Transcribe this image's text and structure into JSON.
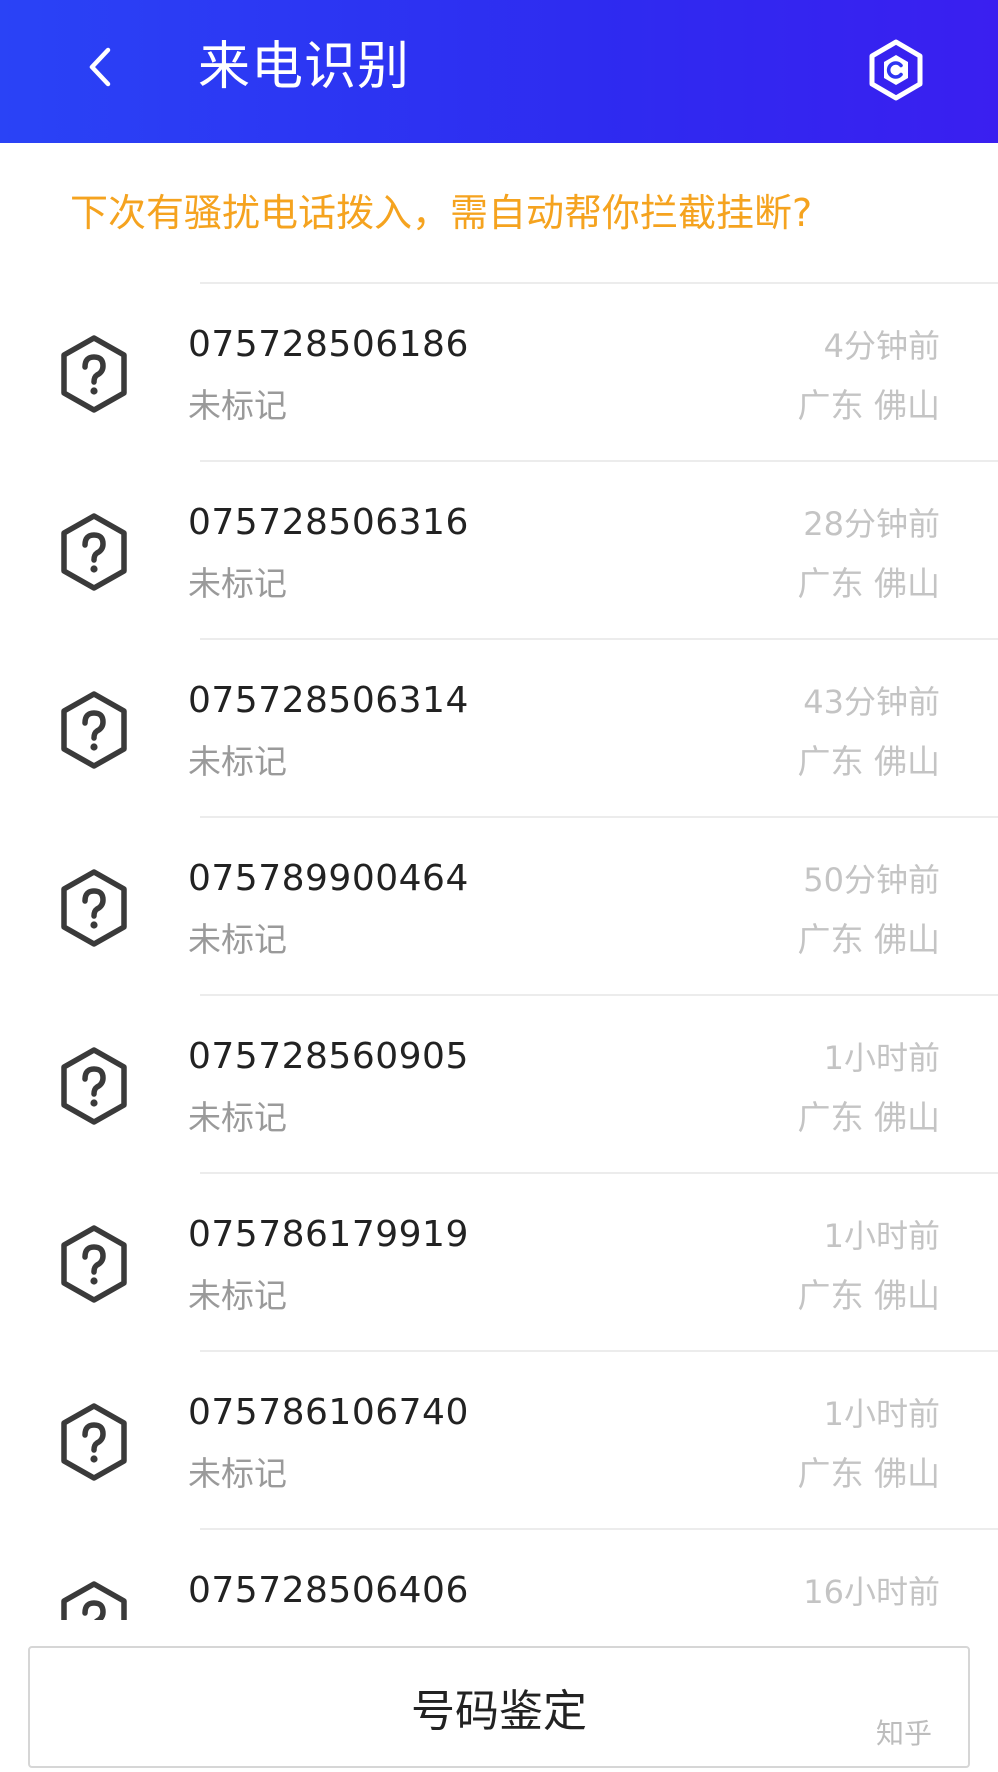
{
  "header": {
    "title": "来电识别",
    "back_icon": "chevron-left-icon",
    "settings_icon": "hexagon-settings-icon",
    "gradient_start": "#2a43f6",
    "gradient_end": "#3a1ff0"
  },
  "prompt": {
    "text": "下次有骚扰电话拨入，需自动帮你拦截挂断?",
    "color": "#f5a31f"
  },
  "calls": [
    {
      "number": "075728506186",
      "status": "未标记",
      "time": "4分钟前",
      "location": "广东 佛山",
      "icon": "hexagon-question-icon"
    },
    {
      "number": "075728506316",
      "status": "未标记",
      "time": "28分钟前",
      "location": "广东 佛山",
      "icon": "hexagon-question-icon"
    },
    {
      "number": "075728506314",
      "status": "未标记",
      "time": "43分钟前",
      "location": "广东 佛山",
      "icon": "hexagon-question-icon"
    },
    {
      "number": "075789900464",
      "status": "未标记",
      "time": "50分钟前",
      "location": "广东 佛山",
      "icon": "hexagon-question-icon"
    },
    {
      "number": "075728560905",
      "status": "未标记",
      "time": "1小时前",
      "location": "广东 佛山",
      "icon": "hexagon-question-icon"
    },
    {
      "number": "075786179919",
      "status": "未标记",
      "time": "1小时前",
      "location": "广东 佛山",
      "icon": "hexagon-question-icon"
    },
    {
      "number": "075786106740",
      "status": "未标记",
      "time": "1小时前",
      "location": "广东 佛山",
      "icon": "hexagon-question-icon"
    },
    {
      "number": "075728506406",
      "status": "",
      "time": "16小时前",
      "location": "",
      "icon": "hexagon-question-icon"
    }
  ],
  "footer": {
    "identify_button_label": "号码鉴定"
  },
  "watermark": {
    "text": "知乎"
  }
}
